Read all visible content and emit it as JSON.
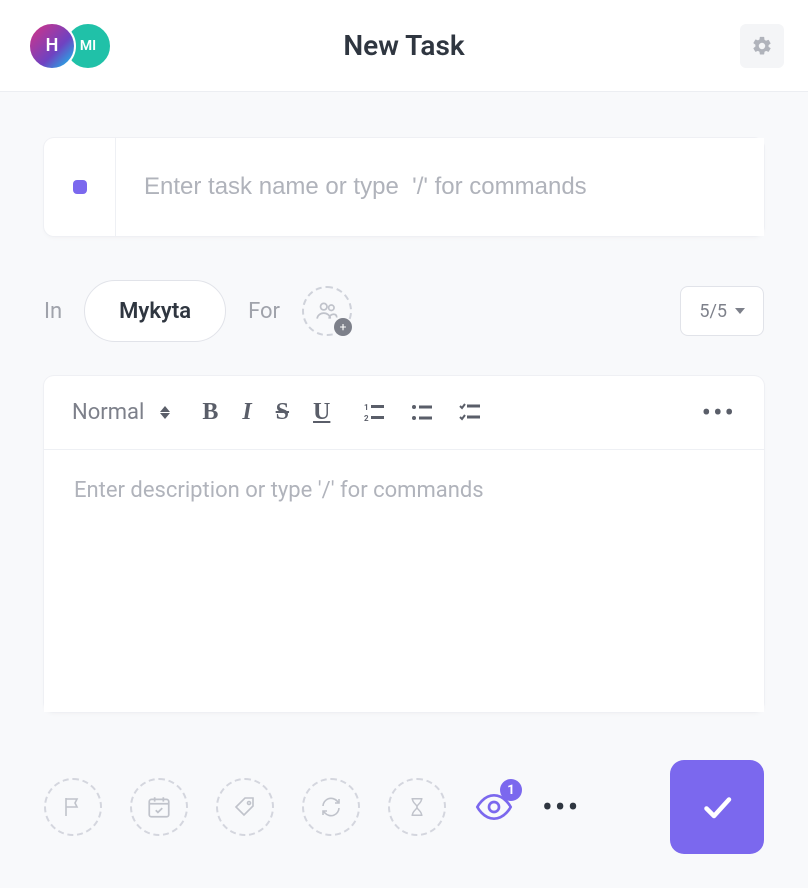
{
  "header": {
    "title": "New Task",
    "avatars": [
      {
        "label": "H",
        "kind": "hive"
      },
      {
        "label": "MI",
        "kind": "mi"
      }
    ]
  },
  "task": {
    "name_placeholder": "Enter task name or type  '/' for commands",
    "name_value": "",
    "status_color": "#7b68ee"
  },
  "meta": {
    "in_label": "In",
    "list_name": "Mykyta",
    "for_label": "For",
    "priority_label": "5/5"
  },
  "editor": {
    "format_label": "Normal",
    "description_placeholder": "Enter description or type '/' for commands",
    "description_value": ""
  },
  "footer": {
    "watch_count": "1"
  }
}
